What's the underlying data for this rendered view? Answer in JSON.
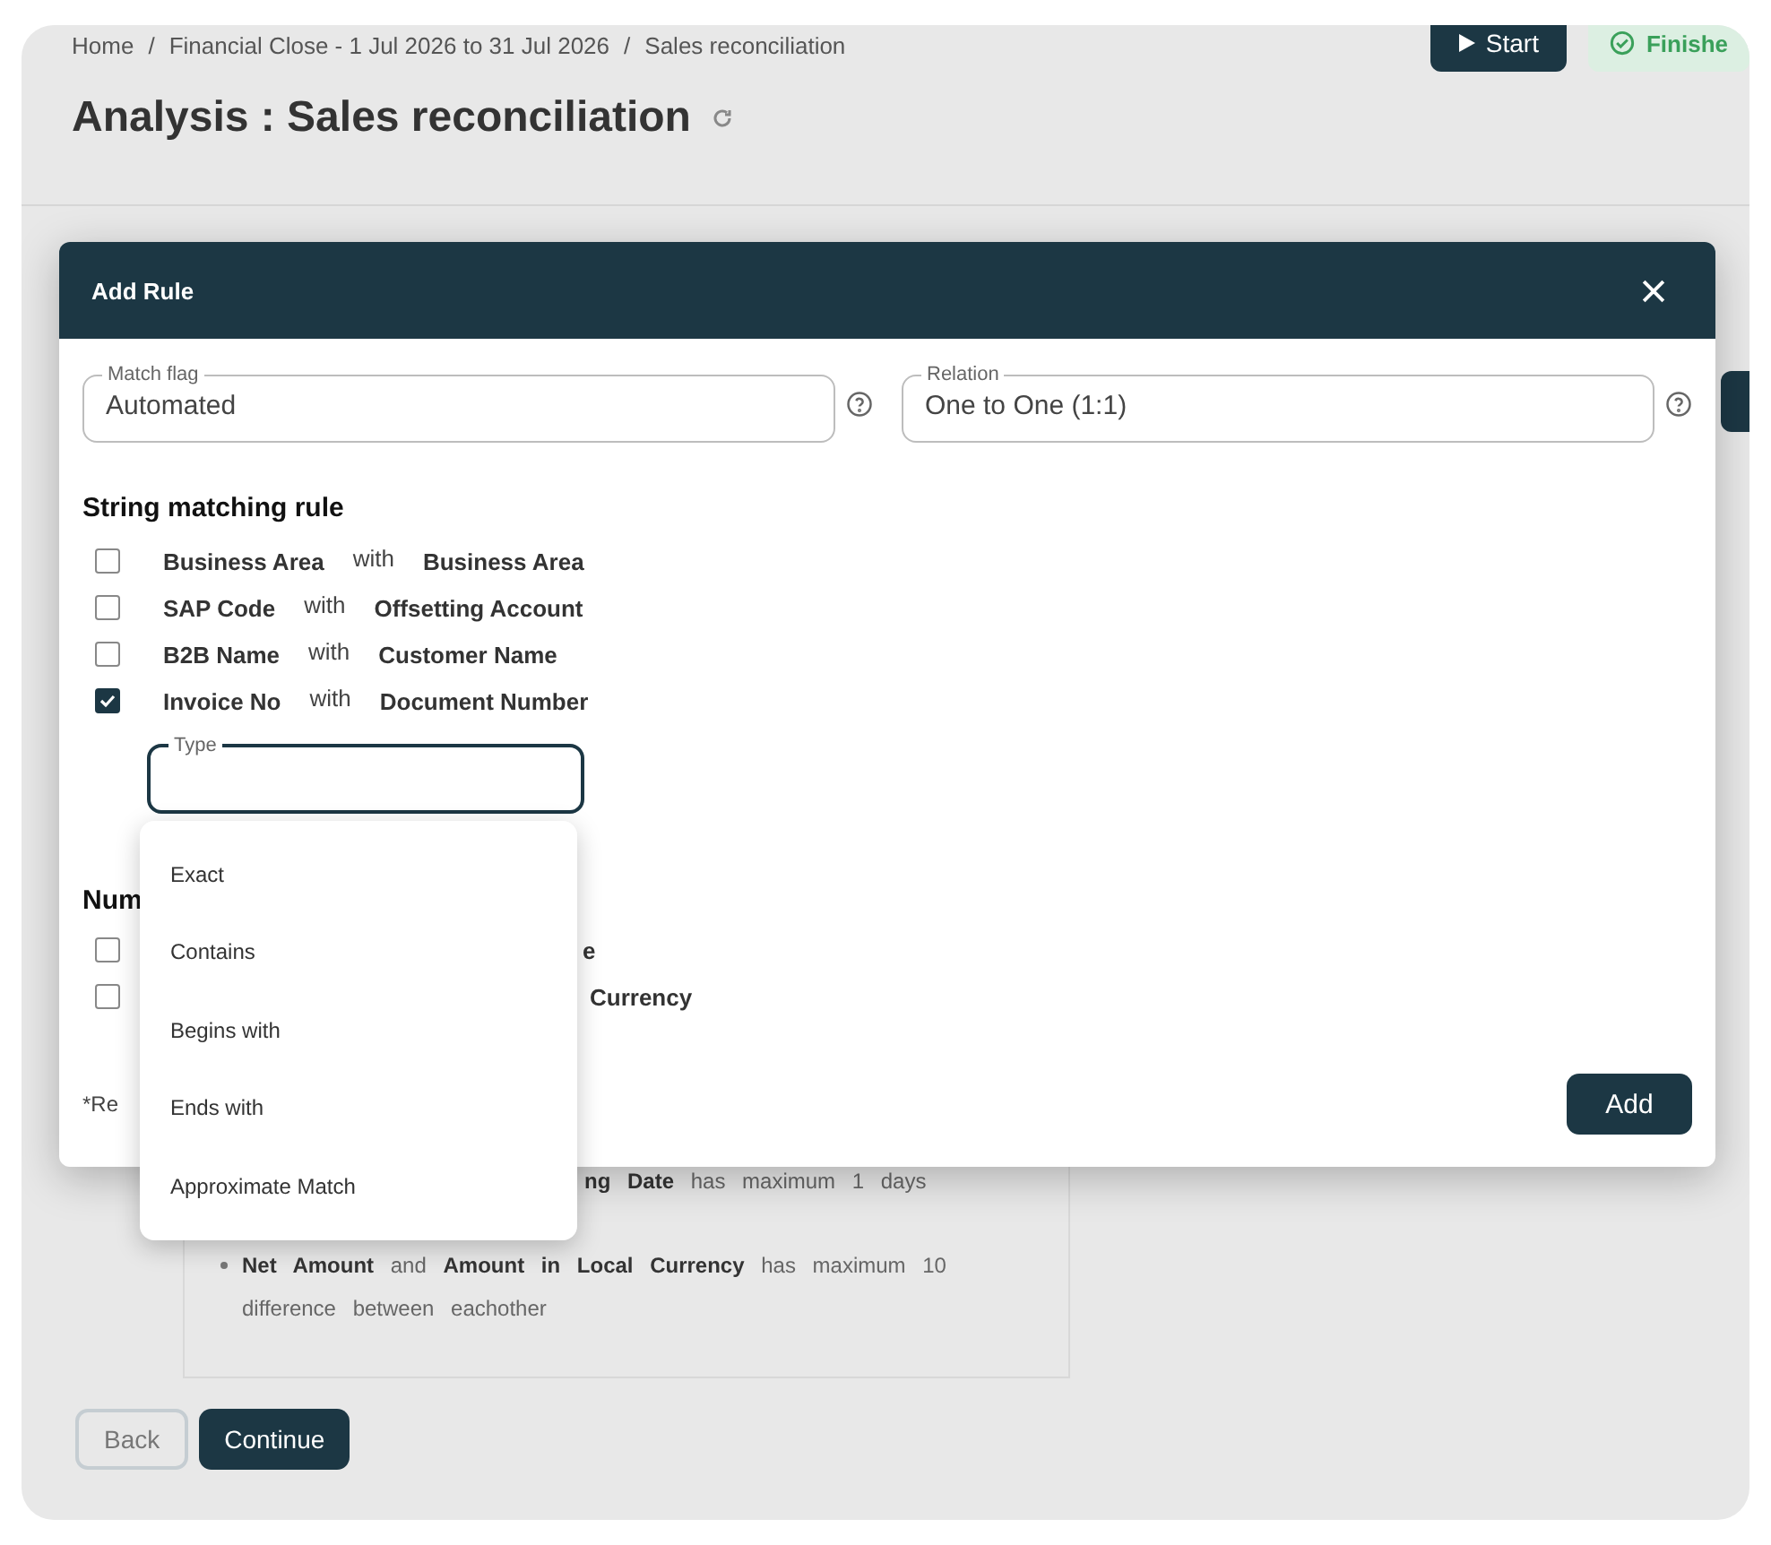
{
  "page": {
    "breadcrumb": {
      "items": [
        "Home",
        "Financial Close - 1 Jul 2026 to 31 Jul 2026",
        "Sales reconciliation"
      ],
      "separator": "/"
    },
    "start_button": "Start",
    "status_chip": "Finishe",
    "title": "Analysis : Sales reconciliation",
    "rules_panel": [
      {
        "kind": "plain",
        "text": "**ng Date** has maximum 1 days"
      },
      {
        "kind": "bullet",
        "text": "**Net Amount** and **Amount in Local Currency** has maximum 10 difference between eachother"
      }
    ],
    "buttons": [
      {
        "label": "Back",
        "kind": "outline"
      },
      {
        "label": "Continue",
        "kind": "primary"
      }
    ]
  },
  "dialog": {
    "title": "Add Rule",
    "fields": [
      {
        "label": "Match flag",
        "value": "Automated"
      },
      {
        "label": "Relation",
        "value": "One to One (1:1)"
      }
    ],
    "string_rules": {
      "heading": "String matching rule",
      "rows": [
        {
          "left": "Business Area",
          "joiner": "with",
          "right": "Business Area",
          "checked": false
        },
        {
          "left": "SAP Code",
          "joiner": "with",
          "right": "Offsetting Account",
          "checked": false
        },
        {
          "left": "B2B Name",
          "joiner": "with",
          "right": "Customer Name",
          "checked": false
        },
        {
          "left": "Invoice No",
          "joiner": "with",
          "right": "Document Number",
          "checked": true
        }
      ]
    },
    "type_field": {
      "label": "Type",
      "focused": true
    },
    "numeric_rules": {
      "heading": "Num",
      "rows": [
        {
          "text": "e",
          "checked": false
        },
        {
          "text": "Currency",
          "checked": false
        }
      ]
    },
    "footnote": "*Re",
    "add_button": "Add"
  },
  "type_menu": {
    "options": [
      "Exact",
      "Contains",
      "Begins with",
      "Ends with",
      "Approximate Match"
    ]
  }
}
